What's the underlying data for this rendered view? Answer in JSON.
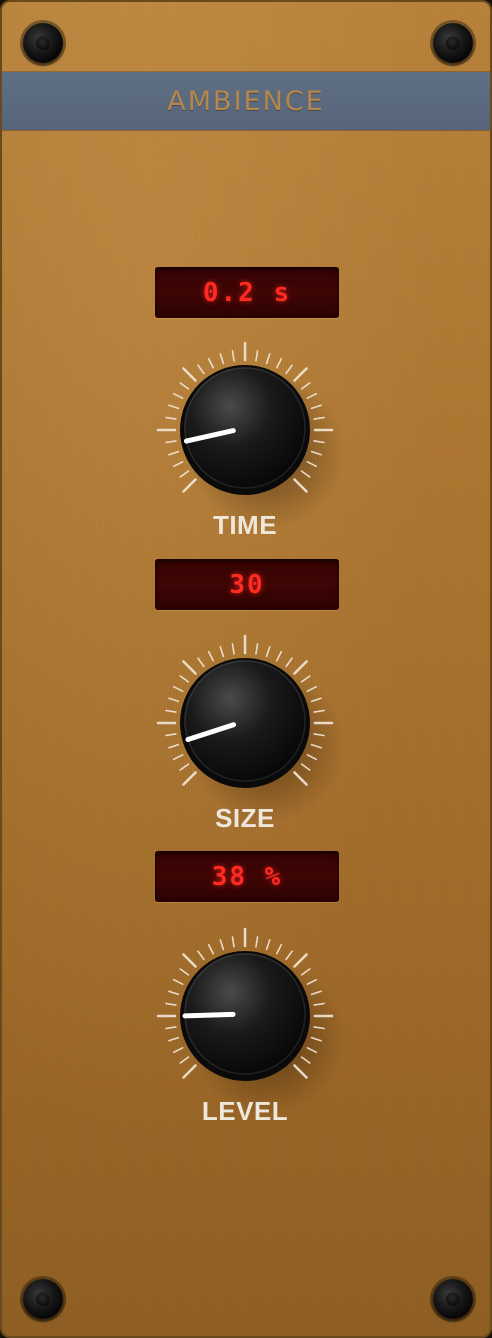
{
  "module": {
    "title": "AMBIENCE"
  },
  "controls": [
    {
      "display": "0.2 s",
      "label": "TIME",
      "knob_position": 0.12
    },
    {
      "display": "30",
      "label": "SIZE",
      "knob_position": 0.1
    },
    {
      "display": "38 %",
      "label": "LEVEL",
      "knob_position": 0.16
    }
  ],
  "colors": {
    "panel": "#ad7630",
    "title_bar": "#5f6f84",
    "title_text": "#b6864a",
    "display_bg": "#3a0404",
    "display_text": "#ff2a22",
    "label_text": "#efe6dc",
    "knob": "#111111",
    "indicator": "#ffffff"
  }
}
